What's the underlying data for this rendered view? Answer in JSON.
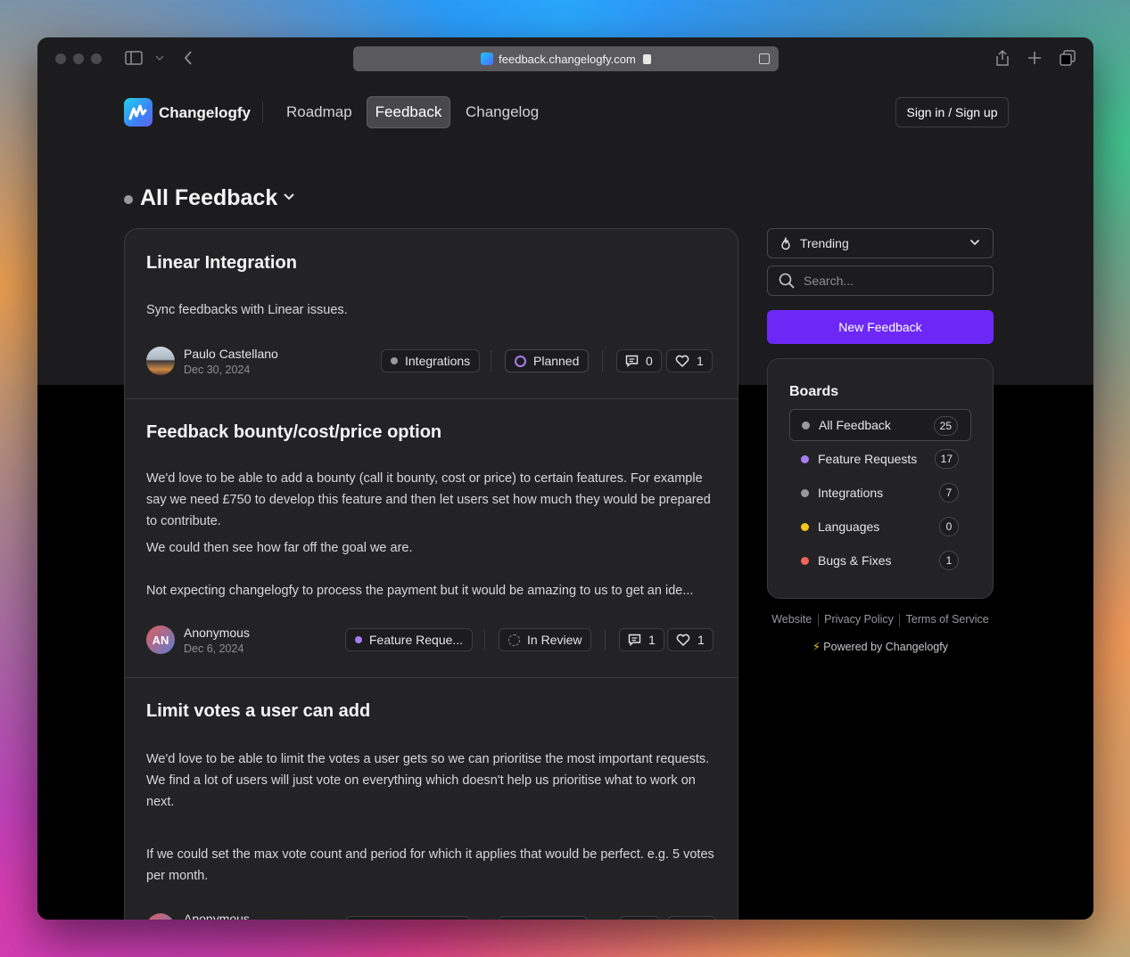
{
  "browser": {
    "url": "feedback.changelogfy.com"
  },
  "nav": {
    "brand": "Changelogfy",
    "links": [
      "Roadmap",
      "Feedback",
      "Changelog"
    ],
    "active": "Feedback",
    "signin": "Sign in / Sign up"
  },
  "heading": "All Feedback",
  "posts": [
    {
      "title": "Linear Integration",
      "body": [
        "Sync feedbacks with Linear issues."
      ],
      "author": "Paulo Castellano",
      "date": "Dec 30, 2024",
      "board": "Integrations",
      "status": "Planned",
      "comments": "0",
      "votes": "1"
    },
    {
      "title": "Feedback bounty/cost/price option",
      "body": [
        "We'd love to be able to add a bounty (call it bounty, cost or price) to certain features. For example say we need £750 to develop this feature and then let users set how much they would be prepared to contribute.",
        "We could then see how far off the goal we are.",
        "Not expecting changelogfy to process the payment but it would be amazing to us to get an ide..."
      ],
      "author": "Anonymous",
      "avatar_initials": "AN",
      "date": "Dec 6, 2024",
      "board": "Feature Reque...",
      "status": "In Review",
      "comments": "1",
      "votes": "1"
    },
    {
      "title": "Limit votes a user can add",
      "body": [
        "We'd love to be able to limit the votes a user gets so we can prioritise the most important requests. We find a lot of users will just vote on everything which doesn't help us prioritise what to work on next.",
        "If we could set the max vote count and period for which it applies that would be perfect. e.g. 5 votes per month."
      ],
      "author": "Anonymous"
    }
  ],
  "sidebar": {
    "sort": "Trending",
    "search_placeholder": "Search...",
    "new_button": "New Feedback",
    "boards_title": "Boards",
    "boards": [
      {
        "name": "All Feedback",
        "count": "25",
        "color": "#98989d"
      },
      {
        "name": "Feature Requests",
        "count": "17",
        "color": "#a87cf0"
      },
      {
        "name": "Integrations",
        "count": "7",
        "color": "#98989d"
      },
      {
        "name": "Languages",
        "count": "0",
        "color": "#f5c518"
      },
      {
        "name": "Bugs & Fixes",
        "count": "1",
        "color": "#f0645c"
      }
    ],
    "footer_links": [
      "Website",
      "Privacy Policy",
      "Terms of Service"
    ],
    "powered_by": "Powered by Changelogfy"
  },
  "colors": {
    "accent": "#6d28f8",
    "planned": "#a87cf0"
  }
}
